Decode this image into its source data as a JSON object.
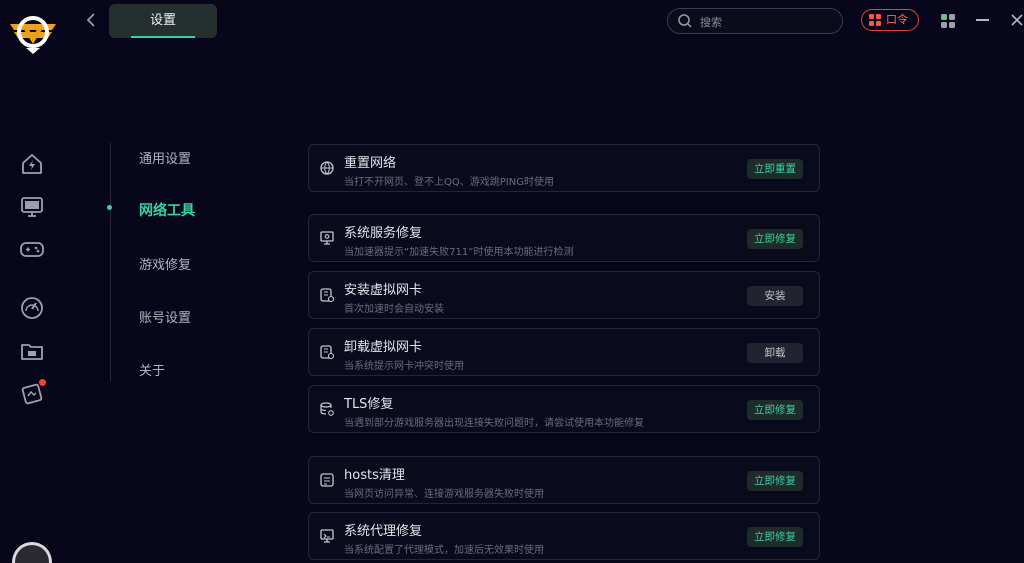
{
  "header": {
    "tab_label": "设置",
    "search_placeholder": "搜索",
    "koling_label": "口令"
  },
  "nav": {
    "items": [
      {
        "label": "通用设置",
        "active": false
      },
      {
        "label": "网络工具",
        "active": true
      },
      {
        "label": "游戏修复",
        "active": false
      },
      {
        "label": "账号设置",
        "active": false
      },
      {
        "label": "关于",
        "active": false
      }
    ]
  },
  "rail": {
    "icons": [
      "home-speed-icon",
      "monitor-icon",
      "gamepad-icon",
      "gauge-icon",
      "folder-icon",
      "game-card-icon"
    ]
  },
  "tools": [
    {
      "title": "重置网络",
      "desc": "当打不开网页、登不上QQ、游戏跳PING时使用",
      "button": "立即重置",
      "icon": "network-reset-icon"
    },
    {
      "title": "系统服务修复",
      "desc": "当加速器提示“加速失败711”时使用本功能进行检测",
      "button": "立即修复",
      "icon": "service-monitor-icon"
    },
    {
      "title": "安装虚拟网卡",
      "desc": "首次加速时会自动安装",
      "button": "安装",
      "icon": "network-card-icon"
    },
    {
      "title": "卸载虚拟网卡",
      "desc": "当系统提示网卡冲突时使用",
      "button": "卸载",
      "icon": "network-card-icon"
    },
    {
      "title": "TLS修复",
      "desc": "当遇到部分游戏服务器出现连接失败问题时，请尝试使用本功能修复",
      "button": "立即修复",
      "icon": "database-gear-icon"
    },
    {
      "title": "hosts清理",
      "desc": "当网页访问异常、连接游戏服务器失败时使用",
      "button": "立即修复",
      "icon": "document-list-icon"
    },
    {
      "title": "系统代理修复",
      "desc": "当系统配置了代理模式，加速后无效果时使用",
      "button": "立即修复",
      "icon": "proxy-monitor-icon"
    }
  ],
  "colors": {
    "accent": "#3ad0a0",
    "background": "#07061a",
    "danger": "#e0443a"
  }
}
